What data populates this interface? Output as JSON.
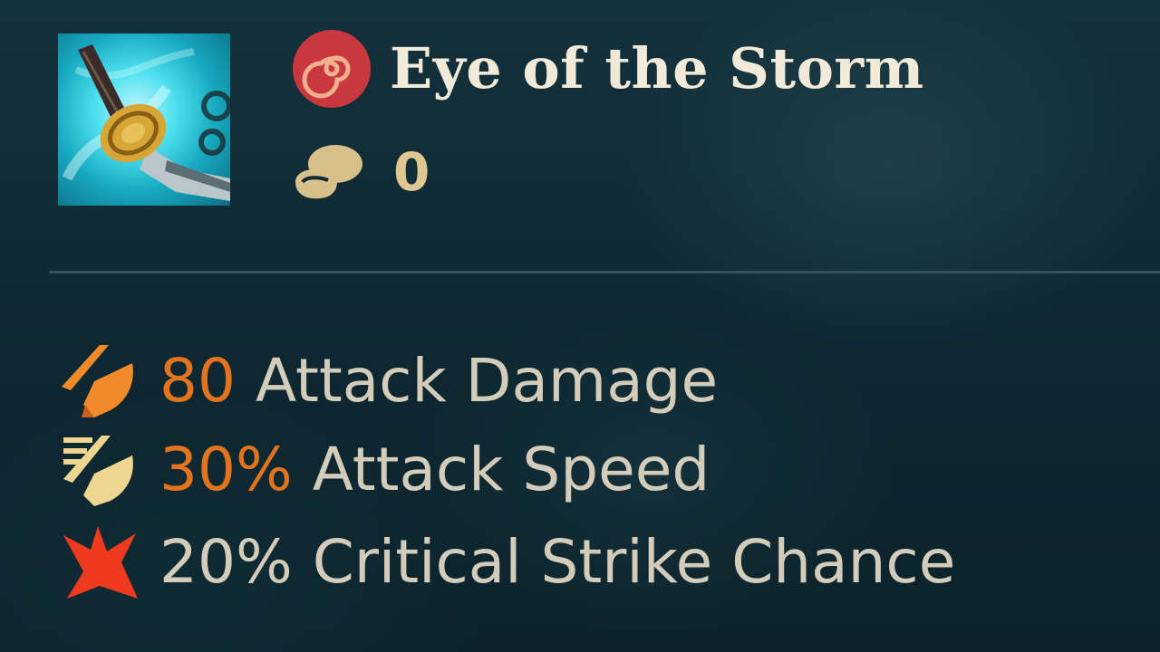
{
  "item": {
    "name": "Eye of the Storm",
    "cost": "0",
    "icon": "katana-item-icon",
    "rarity_icon": "spiral-rune-icon",
    "cost_icon": "gold-coin-icon"
  },
  "stats": [
    {
      "value": "80",
      "label": "Attack Damage",
      "icon": "attack-damage-icon",
      "value_color": "#e2731f"
    },
    {
      "value": "30%",
      "label": "Attack Speed",
      "icon": "attack-speed-icon",
      "value_color": "#e2731f"
    },
    {
      "value": "20%",
      "label": "Critical Strike Chance",
      "icon": "critical-strike-icon",
      "value_color": "#d3ccbb"
    }
  ],
  "colors": {
    "background": "#0f2a33",
    "title": "#f2ead8",
    "gold": "#e0c792",
    "stat_accent": "#e2731f",
    "crit_red": "#ee3b20"
  }
}
